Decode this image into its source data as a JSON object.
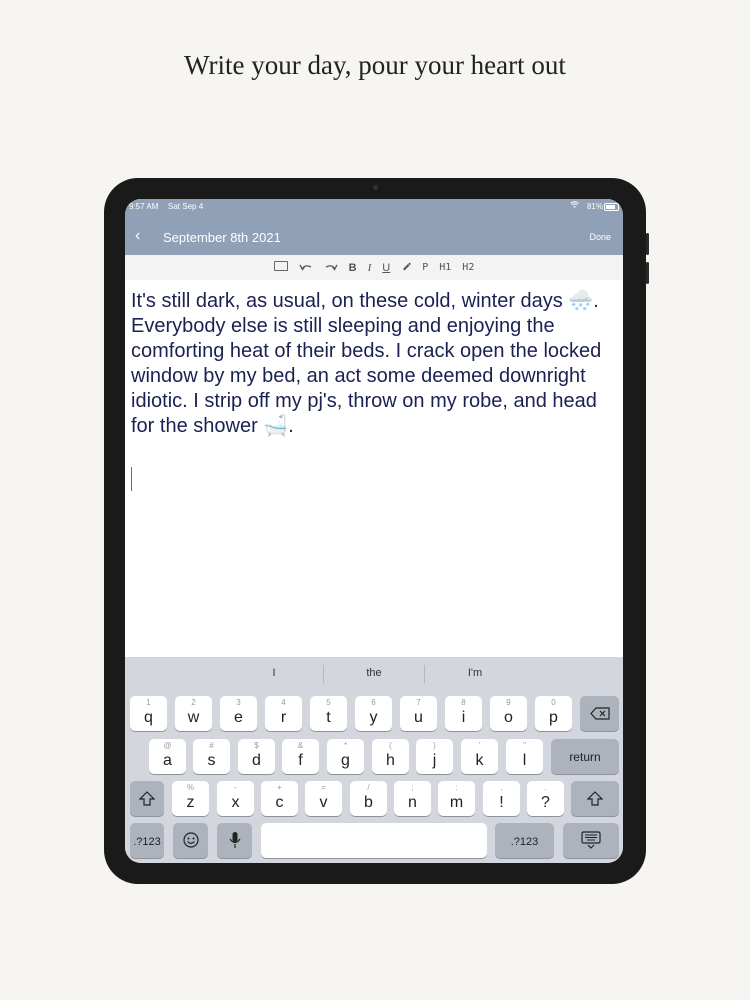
{
  "headline": "Write your day, pour your heart out",
  "status": {
    "time": "9:57 AM",
    "date": "Sat Sep 4",
    "battery": "81%"
  },
  "nav": {
    "title": "September 8th 2021",
    "done": "Done"
  },
  "toolbar": {
    "bold": "B",
    "italic": "I",
    "underline": "U",
    "paragraph": "P",
    "h1": "H1",
    "h2": "H2"
  },
  "editor": {
    "text": "It's still dark, as usual, on these cold, winter days 🌨️. Everybody else is still sleeping and enjoying the comforting heat of their beds. I crack open the locked window by my bed, an act some deemed downright idiotic. I strip off my pj's, throw on my robe, and head for the shower 🛁."
  },
  "suggestions": [
    "I",
    "the",
    "I'm"
  ],
  "keyboard": {
    "row1": [
      {
        "k": "q",
        "h": "1"
      },
      {
        "k": "w",
        "h": "2"
      },
      {
        "k": "e",
        "h": "3"
      },
      {
        "k": "r",
        "h": "4"
      },
      {
        "k": "t",
        "h": "5"
      },
      {
        "k": "y",
        "h": "6"
      },
      {
        "k": "u",
        "h": "7"
      },
      {
        "k": "i",
        "h": "8"
      },
      {
        "k": "o",
        "h": "9"
      },
      {
        "k": "p",
        "h": "0"
      }
    ],
    "row2": [
      {
        "k": "a",
        "h": "@"
      },
      {
        "k": "s",
        "h": "#"
      },
      {
        "k": "d",
        "h": "$"
      },
      {
        "k": "f",
        "h": "&"
      },
      {
        "k": "g",
        "h": "*"
      },
      {
        "k": "h",
        "h": "("
      },
      {
        "k": "j",
        "h": ")"
      },
      {
        "k": "k",
        "h": "'"
      },
      {
        "k": "l",
        "h": "\""
      }
    ],
    "row3": [
      {
        "k": "z",
        "h": "%"
      },
      {
        "k": "x",
        "h": "-"
      },
      {
        "k": "c",
        "h": "+"
      },
      {
        "k": "v",
        "h": "="
      },
      {
        "k": "b",
        "h": "/"
      },
      {
        "k": "n",
        "h": ";"
      },
      {
        "k": "m",
        "h": ":"
      },
      {
        "k": "!",
        "h": ","
      },
      {
        "k": "?",
        "h": "."
      }
    ],
    "return": "return",
    "numbers": ".?123"
  }
}
